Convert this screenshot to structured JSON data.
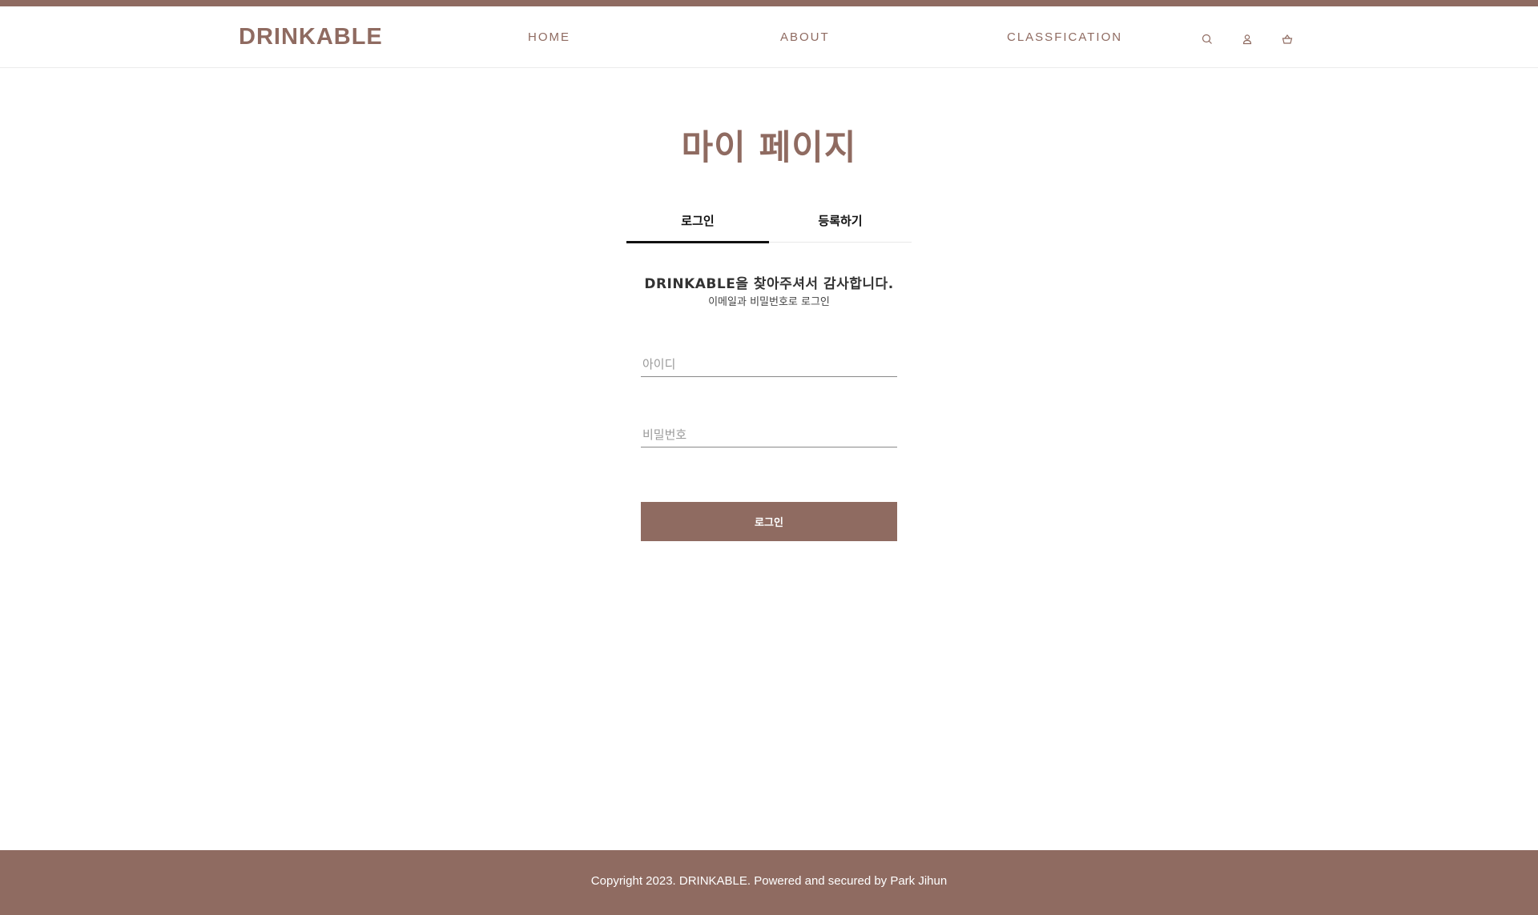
{
  "header": {
    "logo": "DRINKABLE",
    "nav": {
      "home": "HOME",
      "about": "ABOUT",
      "classification": "CLASSFICATION"
    },
    "icons": [
      "search-icon",
      "user-icon",
      "cart-icon"
    ]
  },
  "main": {
    "title": "마이 페이지",
    "tabs": {
      "login": "로그인",
      "register": "등록하기"
    },
    "active_tab": "login",
    "welcome": "DRINKABLE을 찾아주셔서 감사합니다.",
    "subtitle": "이메일과 비밀번호로 로그인",
    "id_placeholder": "아이디",
    "password_placeholder": "비밀번호",
    "login_button": "로그인"
  },
  "footer": {
    "copyright": "Copyright 2023. DRINKABLE. Powered and secured by Park Jihun"
  },
  "colors": {
    "brand": "#8f6b61",
    "text": "#111111",
    "background": "#ffffff"
  }
}
